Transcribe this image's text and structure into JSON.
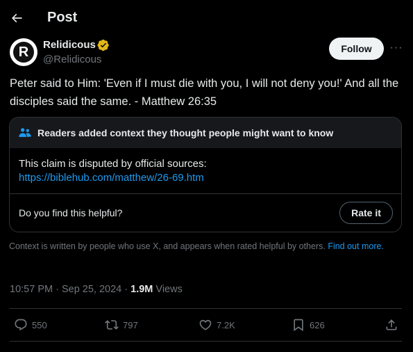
{
  "header": {
    "title": "Post"
  },
  "author": {
    "display_name": "Relidicous",
    "handle": "@Relidicous",
    "avatar_letter": "R",
    "verified_color": "#e2b719"
  },
  "buttons": {
    "follow": "Follow",
    "more": "···"
  },
  "tweet": {
    "text": "Peter said to Him: 'Even if I must die with you, I will not deny you!' And all the disciples said the same. - Matthew 26:35"
  },
  "community_note": {
    "title": "Readers added context they thought people might want to know",
    "body": "This claim is disputed by official sources:",
    "link": "https://biblehub.com/matthew/26-69.htm",
    "helpful_question": "Do you find this helpful?",
    "rate_button": "Rate it"
  },
  "context_disclaimer": {
    "text": "Context is written by people who use X, and appears when rated helpful by others. ",
    "link_text": "Find out more."
  },
  "meta": {
    "time": "10:57 PM",
    "separator": " · ",
    "date": "Sep 25, 2024",
    "views_count": "1.9M",
    "views_label": " Views"
  },
  "actions": {
    "replies": "550",
    "reposts": "797",
    "likes": "7.2K",
    "bookmarks": "626"
  },
  "colors": {
    "background": "#000000",
    "text": "#e7e9ea",
    "muted": "#71767b",
    "link": "#1d9bf0",
    "border": "#2f3336"
  }
}
